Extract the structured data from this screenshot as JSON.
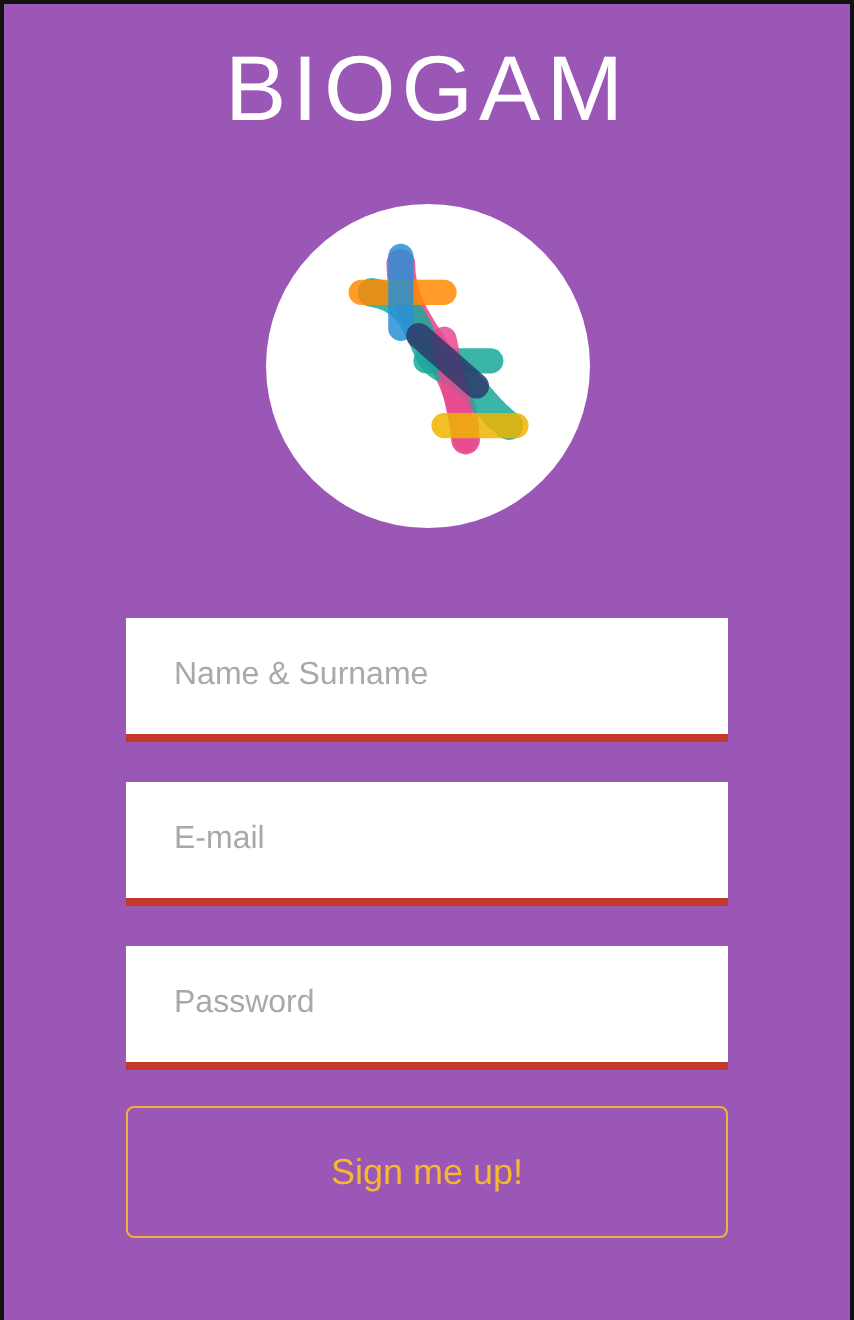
{
  "app_title": "BIOGAM",
  "fields": [
    {
      "placeholder": "Name & Surname"
    },
    {
      "placeholder": "E-mail"
    },
    {
      "placeholder": "Password"
    }
  ],
  "signup_button": {
    "label": "Sign me up!"
  }
}
